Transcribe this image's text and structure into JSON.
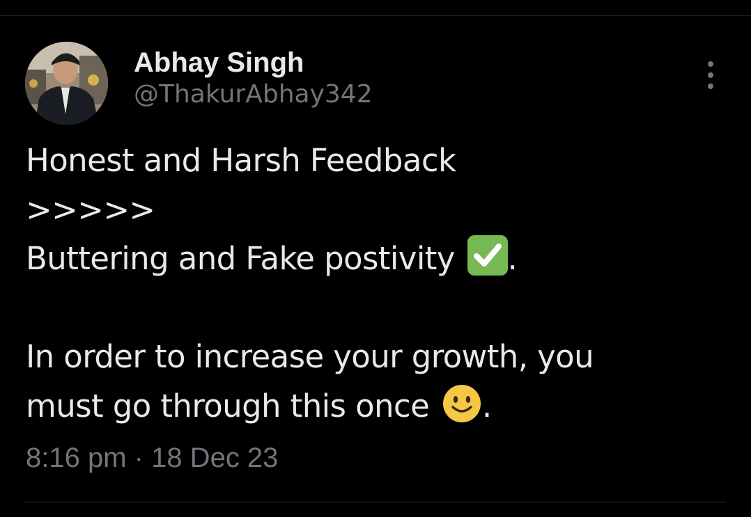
{
  "tweet": {
    "author": {
      "display_name": "Abhay Singh",
      "handle": "@ThakurAbhay342",
      "avatar_icon": "profile-photo"
    },
    "more_icon": "more-vertical-icon",
    "text_lines": {
      "line1": "Honest and Harsh Feedback",
      "line2": ">>>>>",
      "line3_text": "Buttering and Fake postivity ",
      "line3_emoji": "white-heavy-check-mark-emoji",
      "line3_suffix": ".",
      "line4": "In order to increase your growth, you",
      "line5_text": "must go through this once ",
      "line5_emoji": "slightly-smiling-face-emoji",
      "line5_suffix": "."
    },
    "timestamp": "8:16 pm · 18 Dec 23"
  },
  "colors": {
    "background": "#000000",
    "primary_text": "#e7e9ea",
    "secondary_text": "#71767b",
    "divider": "#2f3336"
  }
}
